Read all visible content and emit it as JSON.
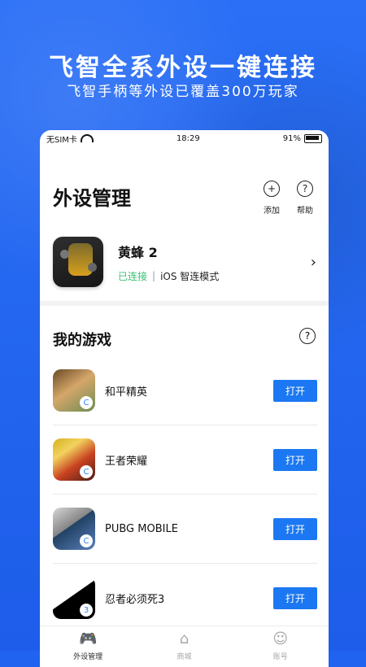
{
  "hero": {
    "title": "飞智全系外设一键连接",
    "subtitle": "飞智手柄等外设已覆盖300万玩家"
  },
  "status_bar": {
    "carrier": "无SIM卡",
    "time": "18:29",
    "battery": "91%"
  },
  "header": {
    "title": "外设管理",
    "actions": [
      {
        "label": "添加",
        "icon": "+"
      },
      {
        "label": "帮助",
        "icon": "?"
      }
    ]
  },
  "device": {
    "name": "黄蜂 2",
    "status": "已连接",
    "separator": "|",
    "mode": "iOS 智连模式",
    "chevron": "›"
  },
  "games_section": {
    "title": "我的游戏",
    "help_icon": "?",
    "items": [
      {
        "name": "和平精英",
        "button": "打开",
        "badge": "C"
      },
      {
        "name": "王者荣耀",
        "button": "打开",
        "badge": "C"
      },
      {
        "name": "PUBG MOBILE",
        "button": "打开",
        "badge": "C"
      },
      {
        "name": "忍者必须死3",
        "button": "打开",
        "badge": "3"
      }
    ]
  },
  "tabs": [
    {
      "label": "外设管理",
      "icon": "🎮"
    },
    {
      "label": "商城",
      "icon": "⌂"
    },
    {
      "label": "账号",
      "icon": "☺"
    }
  ]
}
